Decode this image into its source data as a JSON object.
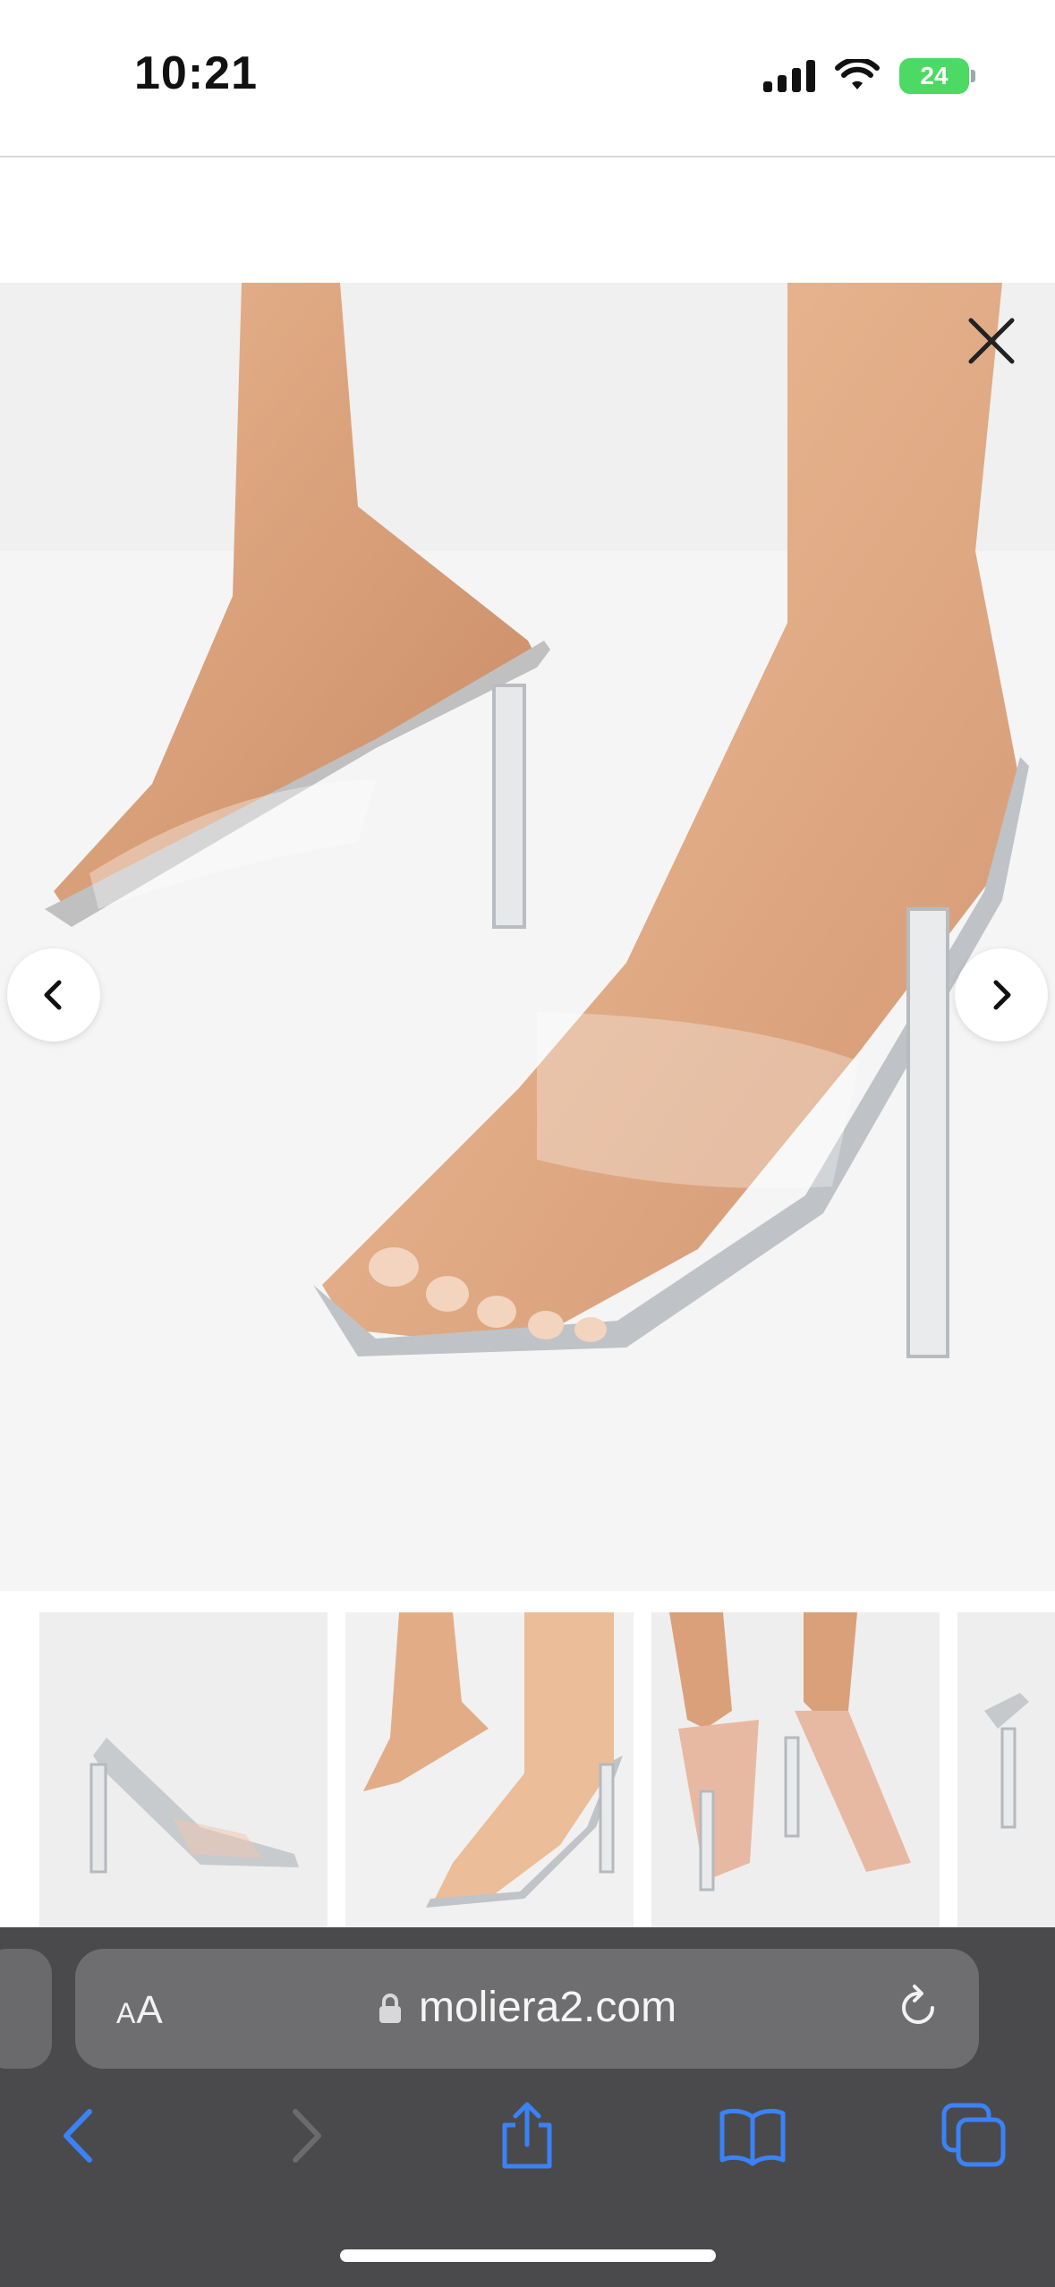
{
  "status_bar": {
    "time": "10:21",
    "battery": "24"
  },
  "colors": {
    "safari_bar": "#4a4a4c",
    "toolbar_icon": "#3b82f6",
    "battery_green": "#4cd964"
  },
  "gallery": {
    "close_icon": "close-icon",
    "prev_icon": "chevron-left-icon",
    "next_icon": "chevron-right-icon",
    "thumbnail_count_visible": 4
  },
  "browser": {
    "text_size_label": "AA",
    "url": "moliera2.com",
    "toolbar": [
      "back",
      "forward",
      "share",
      "bookmarks",
      "tabs"
    ]
  }
}
